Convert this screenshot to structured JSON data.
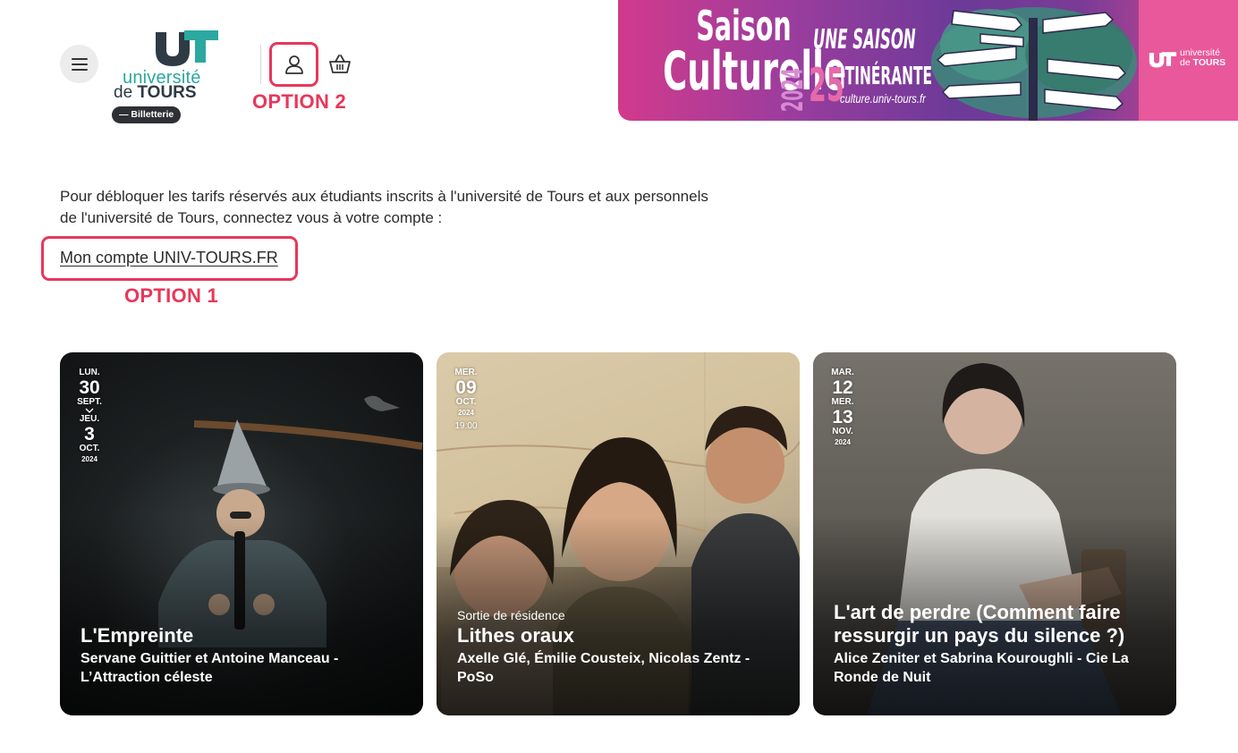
{
  "header": {
    "logo": {
      "line1": "université",
      "line2_prefix": "de ",
      "line2_bold": "TOURS",
      "badge": "— Billetterie"
    },
    "menu_icon": "hamburger-menu-icon",
    "account_icon": "user-icon",
    "cart_icon": "basket-icon"
  },
  "annotations": {
    "option2": "OPTION 2",
    "option1": "OPTION 1",
    "color": "#e8375a"
  },
  "banner": {
    "title_line1": "Saison",
    "title_line2": "Culturelle",
    "year": "2024",
    "subtitle_line1": "UNE SAISON",
    "number": "25",
    "subtitle_line2": "ITINÉRANTE",
    "url": "culture.univ-tours.fr",
    "logo_line1": "université",
    "logo_line2_prefix": "de ",
    "logo_line2_bold": "TOURS"
  },
  "intro": {
    "text": "Pour débloquer les tarifs réservés aux étudiants inscrits à l'université de Tours et aux personnels de l'université de Tours, connectez vous à votre compte :",
    "link": "Mon compte UNIV-TOURS.FR"
  },
  "events": [
    {
      "start": {
        "weekday": "LUN.",
        "day": "30",
        "month": "SEPT."
      },
      "end": {
        "weekday": "JEU.",
        "day": "3",
        "month": "OCT.",
        "year": "2024"
      },
      "kicker": "",
      "title": "L'Empreinte",
      "artist": "Servane Guittier et Antoine Manceau - L’Attraction céleste"
    },
    {
      "start": {
        "weekday": "MER.",
        "day": "09",
        "month": "OCT.",
        "year": "2024",
        "time": "19:00"
      },
      "kicker": "Sortie de résidence",
      "title": "Lithes oraux",
      "artist": "Axelle Glé, Émilie Cousteix, Nicolas Zentz - PoSo"
    },
    {
      "start": {
        "weekday": "MAR.",
        "day": "12",
        "month": ""
      },
      "end": {
        "weekday": "MER.",
        "day": "13",
        "month": "NOV.",
        "year": "2024"
      },
      "kicker": "",
      "title": "L'art de perdre (Comment faire ressurgir un pays du silence ?)",
      "artist": "Alice Zeniter et Sabrina Kouroughli - Cie La Ronde de Nuit"
    }
  ],
  "colors": {
    "accent": "#e8375a",
    "brand_teal": "#2ba8a0",
    "brand_dark": "#2e3b44",
    "banner_pink": "#e8589a",
    "banner_purple": "#6c3a98"
  }
}
